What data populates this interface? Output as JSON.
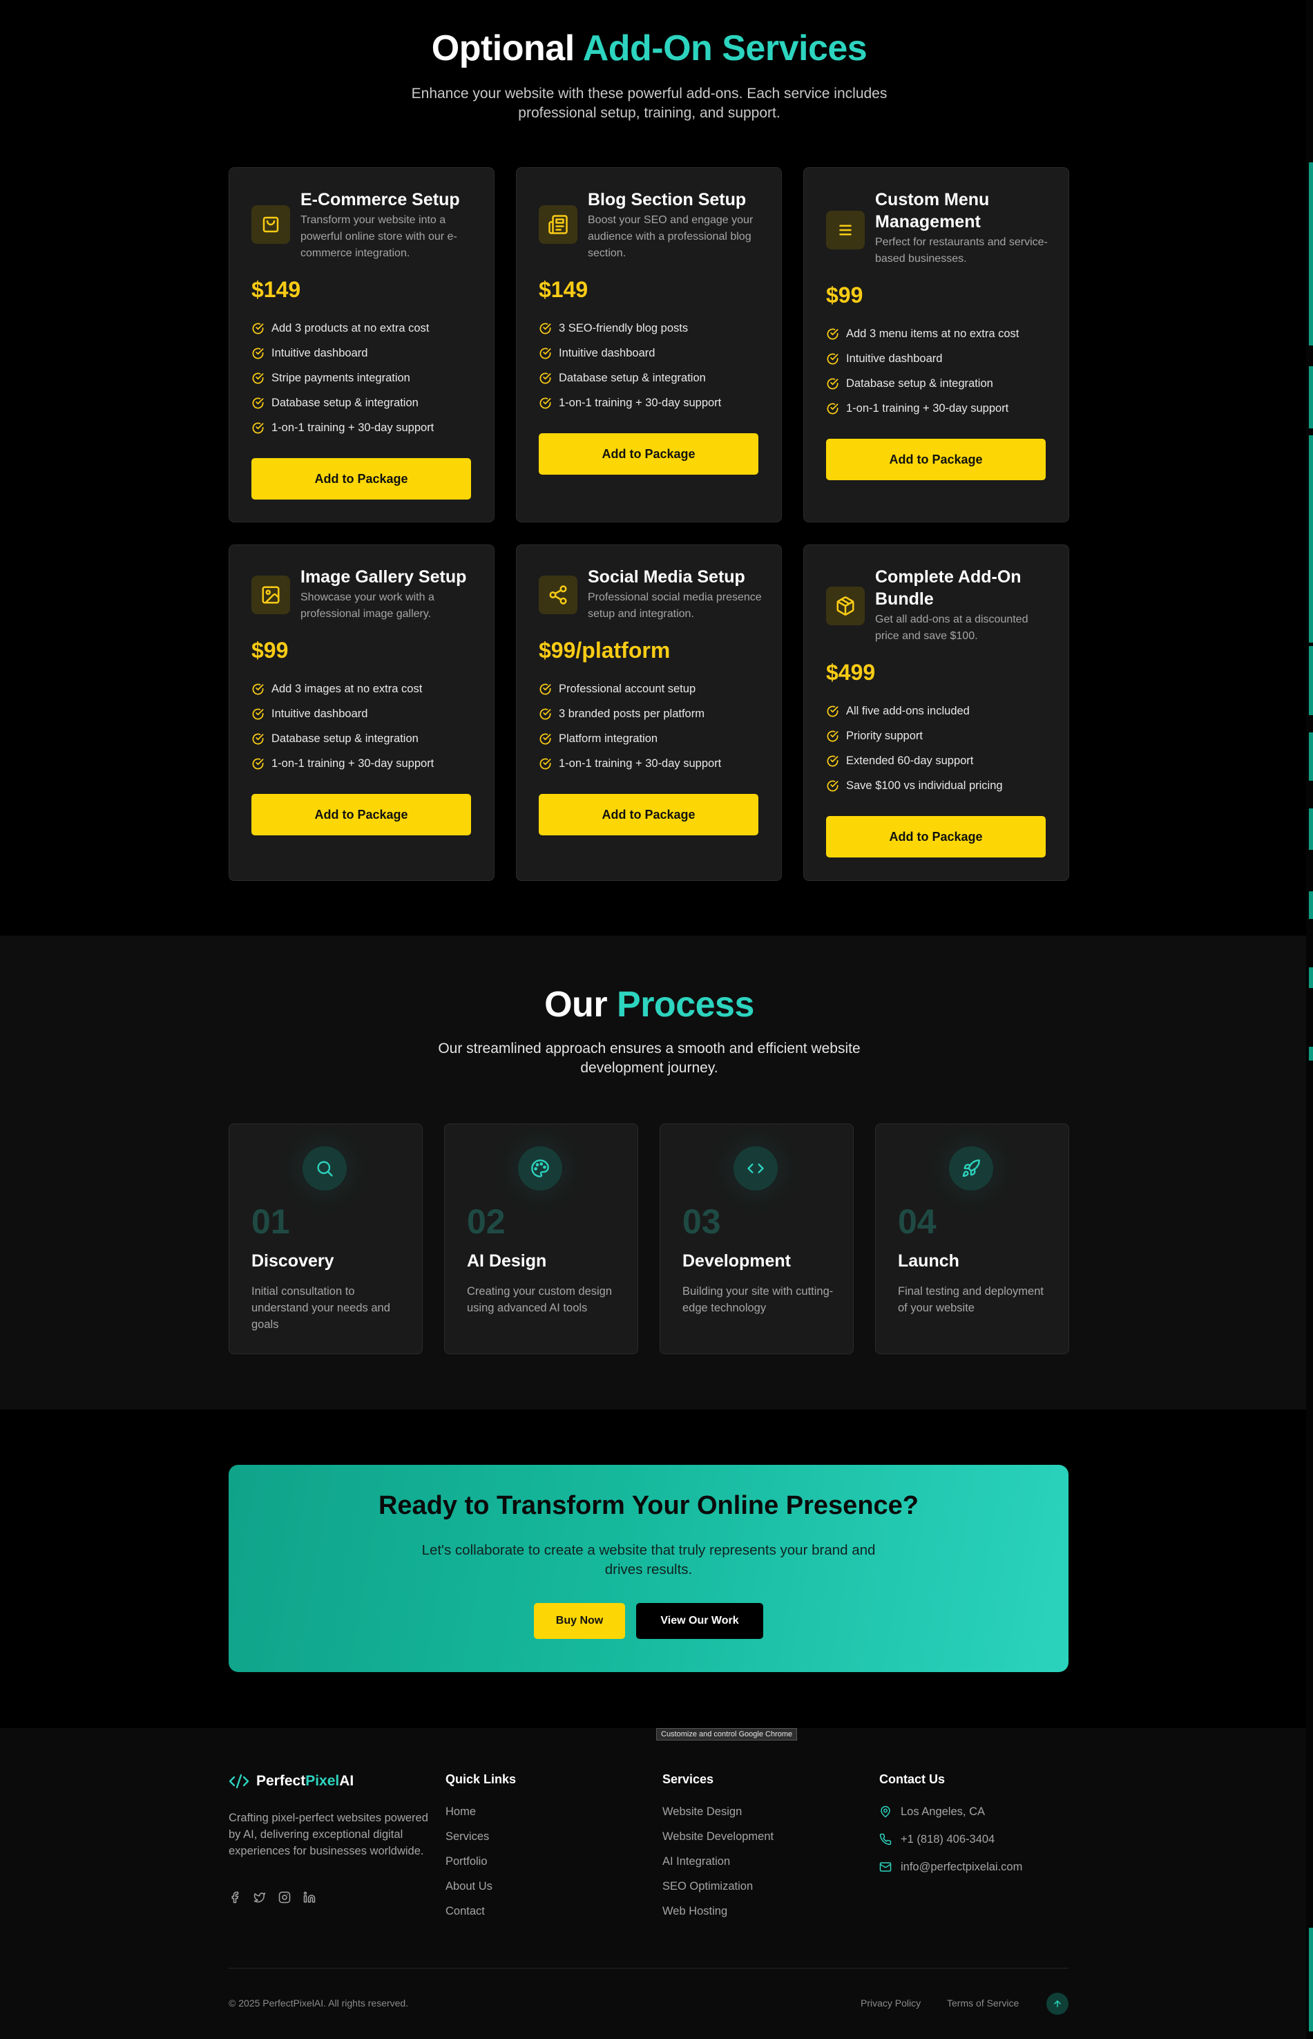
{
  "addons": {
    "title_part1": "Optional",
    "title_part2": "Add-On Services",
    "subtitle": "Enhance your website with these powerful add-ons. Each service includes professional setup, training, and support.",
    "cards": [
      {
        "icon": "shopping-bag-icon",
        "title": "E-Commerce Setup",
        "desc": "Transform your website into a powerful online store with our e-commerce integration.",
        "price": "$149",
        "features": [
          "Add 3 products at no extra cost",
          "Intuitive dashboard",
          "Stripe payments integration",
          "Database setup & integration",
          "1-on-1 training + 30-day support"
        ],
        "button": "Add to Package"
      },
      {
        "icon": "newspaper-icon",
        "title": "Blog Section Setup",
        "desc": "Boost your SEO and engage your audience with a professional blog section.",
        "price": "$149",
        "features": [
          "3 SEO-friendly blog posts",
          "Intuitive dashboard",
          "Database setup & integration",
          "1-on-1 training + 30-day support"
        ],
        "button": "Add to Package"
      },
      {
        "icon": "menu-icon",
        "title": "Custom Menu Management",
        "desc": "Perfect for restaurants and service-based businesses.",
        "price": "$99",
        "features": [
          "Add 3 menu items at no extra cost",
          "Intuitive dashboard",
          "Database setup & integration",
          "1-on-1 training + 30-day support"
        ],
        "button": "Add to Package"
      },
      {
        "icon": "image-icon",
        "title": "Image Gallery Setup",
        "desc": "Showcase your work with a professional image gallery.",
        "price": "$99",
        "features": [
          "Add 3 images at no extra cost",
          "Intuitive dashboard",
          "Database setup & integration",
          "1-on-1 training + 30-day support"
        ],
        "button": "Add to Package"
      },
      {
        "icon": "share-icon",
        "title": "Social Media Setup",
        "desc": "Professional social media presence setup and integration.",
        "price": "$99/platform",
        "features": [
          "Professional account setup",
          "3 branded posts per platform",
          "Platform integration",
          "1-on-1 training + 30-day support"
        ],
        "button": "Add to Package"
      },
      {
        "icon": "package-icon",
        "title": "Complete Add-On Bundle",
        "desc": "Get all add-ons at a discounted price and save $100.",
        "price": "$499",
        "features": [
          "All five add-ons included",
          "Priority support",
          "Extended 60-day support",
          "Save $100 vs individual pricing"
        ],
        "button": "Add to Package"
      }
    ]
  },
  "process": {
    "title_part1": "Our",
    "title_part2": "Process",
    "subtitle": "Our streamlined approach ensures a smooth and efficient website development journey.",
    "steps": [
      {
        "icon": "search-icon",
        "num": "01",
        "title": "Discovery",
        "desc": "Initial consultation to understand your needs and goals"
      },
      {
        "icon": "palette-icon",
        "num": "02",
        "title": "AI Design",
        "desc": "Creating your custom design using advanced AI tools"
      },
      {
        "icon": "code-icon",
        "num": "03",
        "title": "Development",
        "desc": "Building your site with cutting-edge technology"
      },
      {
        "icon": "rocket-icon",
        "num": "04",
        "title": "Launch",
        "desc": "Final testing and deployment of your website"
      }
    ]
  },
  "cta": {
    "title": "Ready to Transform Your Online Presence?",
    "subtitle": "Let's collaborate to create a website that truly represents your brand and drives results.",
    "primary": "Buy Now",
    "secondary": "View Our Work"
  },
  "footer": {
    "tooltip": "Customize and control Google Chrome",
    "logo_part1": "Perfect",
    "logo_part2": "Pixel",
    "logo_part3": "AI",
    "description": "Crafting pixel-perfect websites powered by AI, delivering exceptional digital experiences for businesses worldwide.",
    "quick_links_title": "Quick Links",
    "quick_links": [
      "Home",
      "Services",
      "Portfolio",
      "About Us",
      "Contact"
    ],
    "services_title": "Services",
    "services": [
      "Website Design",
      "Website Development",
      "AI Integration",
      "SEO Optimization",
      "Web Hosting"
    ],
    "contact_title": "Contact Us",
    "contact": {
      "location": "Los Angeles, CA",
      "phone": "+1 (818) 406-3404",
      "email": "info@perfectpixelai.com"
    },
    "copyright": "© 2025 PerfectPixelAI. All rights reserved.",
    "privacy": "Privacy Policy",
    "terms": "Terms of Service"
  },
  "colors": {
    "accent": "#2dd4bf",
    "yellow": "#fcd705",
    "background": "#000000",
    "card": "#1b1b1b"
  }
}
